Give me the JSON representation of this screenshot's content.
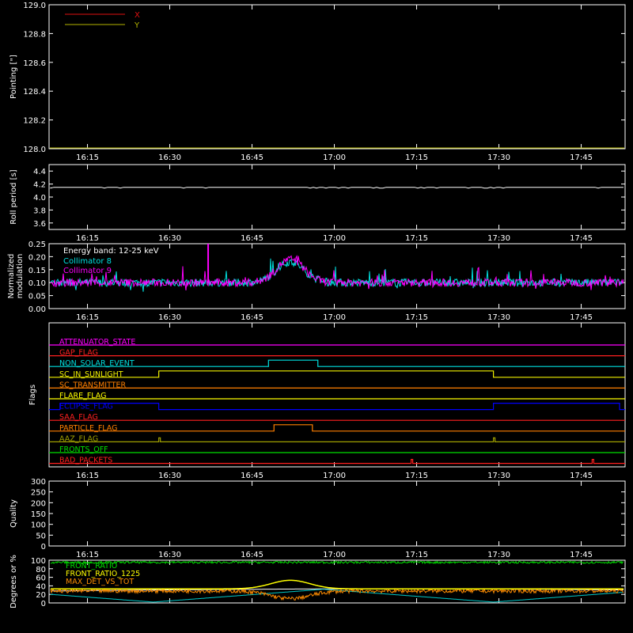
{
  "chart_data": [
    {
      "id": "pointing",
      "type": "line",
      "ylabel": "Pointing [\"]",
      "ylim": [
        128.0,
        129.0
      ],
      "yticks": [
        "128.0",
        "128.2",
        "128.4",
        "128.6",
        "128.8",
        "129.0"
      ],
      "xticks": [
        "16:15",
        "16:30",
        "16:45",
        "17:00",
        "17:15",
        "17:30",
        "17:45"
      ],
      "series": [
        {
          "name": "X",
          "color": "#e01010",
          "values": []
        },
        {
          "name": "Y",
          "color": "#b4b400",
          "values": []
        }
      ]
    },
    {
      "id": "roll-period",
      "type": "line",
      "ylabel": "Roll period [s]",
      "ylim": [
        3.5,
        4.5
      ],
      "yticks": [
        "3.6",
        "3.8",
        "4.0",
        "4.2",
        "4.4"
      ],
      "xticks": [
        "16:15",
        "16:30",
        "16:45",
        "17:00",
        "17:15",
        "17:30",
        "17:45"
      ],
      "series": [
        {
          "name": "",
          "color": "#ffffff",
          "value": 4.15
        }
      ]
    },
    {
      "id": "modulation",
      "type": "line",
      "ylabel": "Normalized modulation",
      "ylim": [
        0.0,
        0.25
      ],
      "yticks": [
        "0.00",
        "0.05",
        "0.10",
        "0.15",
        "0.20",
        "0.25"
      ],
      "xticks": [
        "16:15",
        "16:30",
        "16:45",
        "17:00",
        "17:15",
        "17:30",
        "17:45"
      ],
      "annotation": "Energy band: 12-25 keV",
      "series": [
        {
          "name": "Collimator 8",
          "color": "#00e0e0",
          "baseline": 0.1,
          "peak_time": "16:52",
          "peak_value": 0.18
        },
        {
          "name": "Collimator 9",
          "color": "#ff00ff",
          "baseline": 0.1,
          "peak_time": "16:52",
          "peak_value": 0.19,
          "spike_time": "16:37",
          "spike_value": 0.25
        }
      ]
    },
    {
      "id": "flags",
      "type": "line",
      "ylabel": "Flags",
      "xticks": [
        "16:15",
        "16:30",
        "16:45",
        "17:00",
        "17:15",
        "17:30",
        "17:45"
      ],
      "flags": [
        {
          "name": "ATTENUATOR_STATE",
          "color": "#ff00ff",
          "on": []
        },
        {
          "name": "GAP_FLAG",
          "color": "#ff2020",
          "on": []
        },
        {
          "name": "NON_SOLAR_EVENT",
          "color": "#00e0e0",
          "on": [
            [
              "16:48",
              "16:57"
            ]
          ]
        },
        {
          "name": "SC_IN_SUNLIGHT",
          "color": "#f0f000",
          "on": [
            [
              "16:28",
              "17:29"
            ]
          ]
        },
        {
          "name": "SC_TRANSMITTER",
          "color": "#ff7f00",
          "on": []
        },
        {
          "name": "FLARE_FLAG",
          "color": "#ffff00",
          "on": []
        },
        {
          "name": "ECLIPSE_FLAG",
          "color": "#0000ff",
          "on": [
            [
              "16:10",
              "16:28"
            ],
            [
              "17:29",
              "17:52"
            ]
          ]
        },
        {
          "name": "SAA_FLAG",
          "color": "#ff2020",
          "on": []
        },
        {
          "name": "PARTICLE_FLAG",
          "color": "#ff7f00",
          "on": [
            [
              "16:49",
              "16:56"
            ]
          ]
        },
        {
          "name": "AAZ_FLAG",
          "color": "#a0a000",
          "pulses": [
            "16:28",
            "17:29"
          ]
        },
        {
          "name": "FRONTS_OFF",
          "color": "#00e000",
          "on": []
        },
        {
          "name": "BAD_PACKETS",
          "color": "#ff2020",
          "pulses": [
            "17:14",
            "17:47"
          ]
        }
      ]
    },
    {
      "id": "quality",
      "type": "line",
      "ylabel": "Quality",
      "ylim": [
        0,
        300
      ],
      "yticks": [
        "0",
        "50",
        "100",
        "150",
        "200",
        "250",
        "300"
      ],
      "xticks": [
        "16:15",
        "16:30",
        "16:45",
        "17:00",
        "17:15",
        "17:30",
        "17:45"
      ],
      "series": []
    },
    {
      "id": "ratios",
      "type": "line",
      "ylabel": "Degrees or %",
      "ylim": [
        0,
        100
      ],
      "yticks": [
        "0",
        "20",
        "40",
        "60",
        "80",
        "100"
      ],
      "series": [
        {
          "name": "FRONT_RATIO",
          "color": "#00e000",
          "baseline": 95
        },
        {
          "name": "FRONT_RATIO_1225",
          "color": "#ffff00",
          "baseline": 33,
          "peak": 53
        },
        {
          "name": "MAX_DET_VS_TOT",
          "color": "#ff8c00",
          "baseline": 28,
          "dip": 10
        },
        {
          "name": "",
          "color": "#00c8c8"
        },
        {
          "name": "",
          "color": "#ffffff"
        }
      ]
    }
  ]
}
